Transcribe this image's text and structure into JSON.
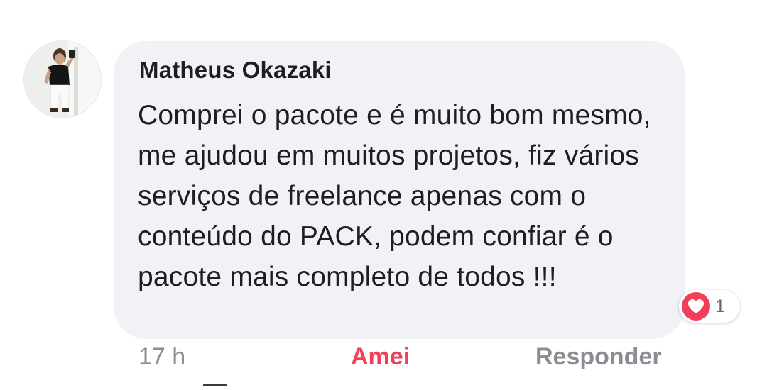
{
  "comment": {
    "author": "Matheus Okazaki",
    "text": "Comprei o pacote e é muito bom mesmo, me ajudou em muitos projetos, fiz vários serviços de freelance apenas com o conteúdo do PACK, podem confiar é o pacote mais completo de todos !!!",
    "time": "17 h",
    "reaction_icon": "heart-icon",
    "reaction_count": "1"
  },
  "actions": {
    "love_label": "Amei",
    "reply_label": "Responder"
  },
  "colors": {
    "bubble": "#f0f2f5",
    "text": "#1c1e21",
    "love": "#f33e58",
    "muted": "#8a8d91"
  }
}
